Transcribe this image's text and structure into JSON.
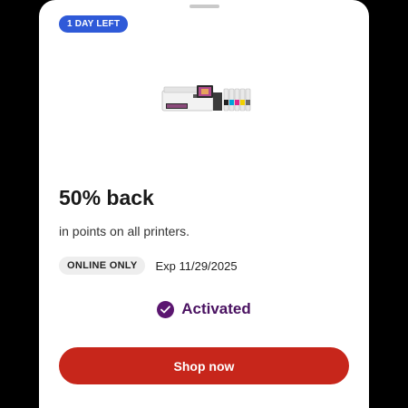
{
  "offer": {
    "badge": "1 DAY LEFT",
    "product_image": "printer-with-ink-bottles",
    "headline": "50% back",
    "subtext": "in points on all printers.",
    "tag": "ONLINE ONLY",
    "expiration": "Exp 11/29/2025",
    "status": {
      "icon": "check-circle-icon",
      "label": "Activated"
    },
    "cta_label": "Shop now"
  },
  "colors": {
    "badge": "#2f5ad8",
    "status": "#5b1670",
    "cta": "#c7261b"
  }
}
